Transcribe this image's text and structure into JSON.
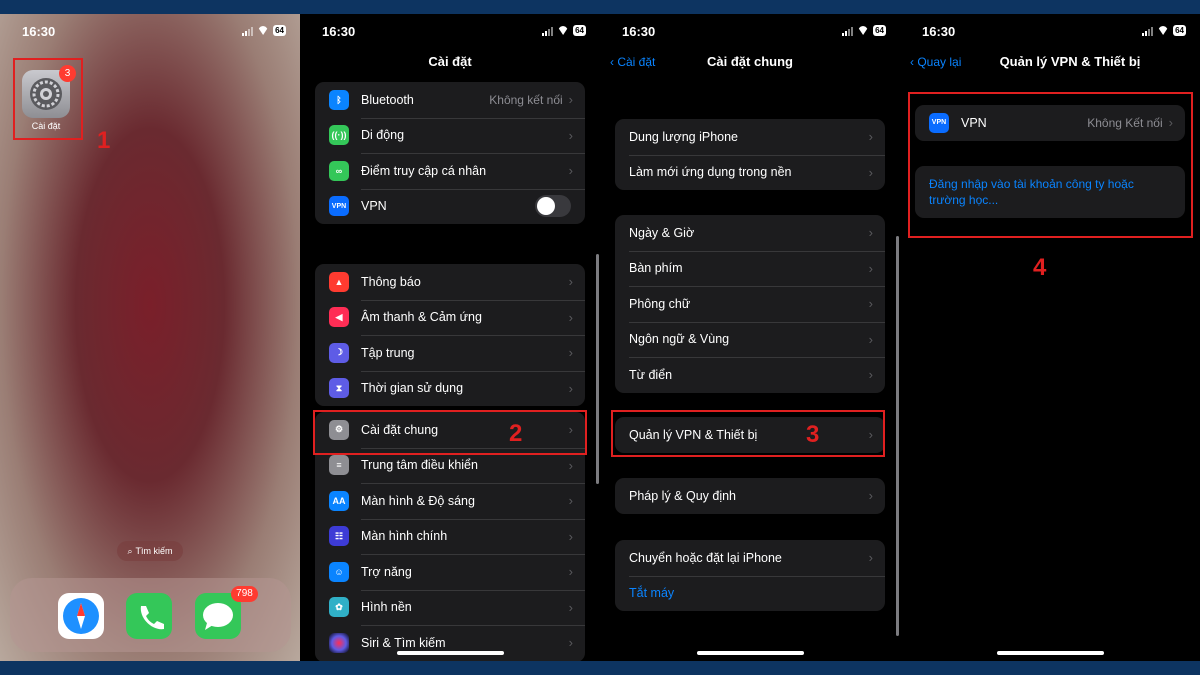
{
  "status": {
    "time": "16:30",
    "battery": "64"
  },
  "home": {
    "settings_label": "Cài đặt",
    "settings_badge": "3",
    "search": "Tìm kiếm",
    "messages_badge": "798",
    "step": "1"
  },
  "settings": {
    "title": "Cài đặt",
    "step": "2",
    "group1": [
      {
        "label": "Bluetooth",
        "value": "Không kết nối",
        "icon": "bluetooth-icon",
        "color": "#0a84ff"
      },
      {
        "label": "Di động",
        "icon": "antenna-icon",
        "color": "#34c759"
      },
      {
        "label": "Điểm truy cập cá nhân",
        "icon": "hotspot-icon",
        "color": "#34c759"
      },
      {
        "label": "VPN",
        "icon": "vpn-icon",
        "color": "#0a6cff",
        "icon_text": "VPN",
        "toggle": false
      }
    ],
    "group2": [
      {
        "label": "Thông báo",
        "icon": "bell-icon",
        "color": "#ff3b30"
      },
      {
        "label": "Âm thanh & Cảm ứng",
        "icon": "speaker-icon",
        "color": "#ff2d55"
      },
      {
        "label": "Tập trung",
        "icon": "moon-icon",
        "color": "#5e5ce6"
      },
      {
        "label": "Thời gian sử dụng",
        "icon": "hourglass-icon",
        "color": "#5e5ce6"
      }
    ],
    "group3": [
      {
        "label": "Cài đặt chung",
        "icon": "gear-icon",
        "color": "#8e8e93"
      },
      {
        "label": "Trung tâm điều khiển",
        "icon": "switches-icon",
        "color": "#8e8e93"
      },
      {
        "label": "Màn hình & Độ sáng",
        "icon": "text-size-icon",
        "color": "#0a84ff",
        "icon_text": "AA"
      },
      {
        "label": "Màn hình chính",
        "icon": "grid-icon",
        "color": "#3d3bd6"
      },
      {
        "label": "Trợ năng",
        "icon": "accessibility-icon",
        "color": "#0a84ff"
      },
      {
        "label": "Hình nền",
        "icon": "flower-icon",
        "color": "#30b0c7"
      },
      {
        "label": "Siri & Tìm kiếm",
        "icon": "siri-icon",
        "color": "#333"
      }
    ]
  },
  "general": {
    "back": "Cài đặt",
    "title": "Cài đặt chung",
    "step": "3",
    "group_a": [
      "Dung lượng iPhone",
      "Làm mới ứng dụng trong nền"
    ],
    "group_b": [
      "Ngày & Giờ",
      "Bàn phím",
      "Phông chữ",
      "Ngôn ngữ & Vùng",
      "Từ điển"
    ],
    "group_c": [
      "Quản lý VPN & Thiết bị"
    ],
    "group_d": [
      "Pháp lý & Quy định"
    ],
    "group_e": [
      "Chuyển hoặc đặt lại iPhone"
    ],
    "shutdown": "Tắt máy"
  },
  "vpn_page": {
    "back": "Quay lại",
    "title": "Quản lý VPN & Thiết bị",
    "vpn_label": "VPN",
    "vpn_icon_text": "VPN",
    "vpn_value": "Không Kết nối",
    "signin": "Đăng nhập vào tài khoản công ty hoặc trường học...",
    "step": "4"
  }
}
